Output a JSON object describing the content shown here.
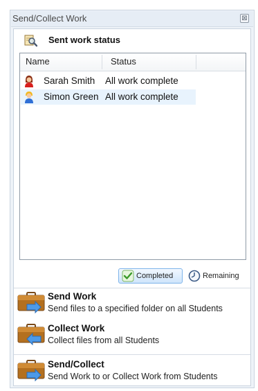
{
  "window": {
    "title": "Send/Collect Work",
    "close_glyph": "⊠"
  },
  "section": {
    "title": "Sent work status",
    "icon": "magnifier-document-icon"
  },
  "list": {
    "columns": [
      "Name",
      "Status"
    ],
    "rows": [
      {
        "name": "Sarah Smith",
        "status": "All work complete",
        "avatar": "student-female-icon",
        "selected": false
      },
      {
        "name": "Simon Green",
        "status": "All work complete",
        "avatar": "student-male-icon",
        "selected": true
      }
    ]
  },
  "legend": {
    "completed_label": "Completed",
    "remaining_label": "Remaining"
  },
  "actions": [
    {
      "title": "Send Work",
      "description": "Send files to a specified folder on all Students",
      "icon": "briefcase-send-icon"
    },
    {
      "title": "Collect Work",
      "description": "Collect files from all Students",
      "icon": "briefcase-collect-icon"
    },
    {
      "title": "Send/Collect",
      "description": "Send Work to or Collect Work from Students",
      "icon": "briefcase-sendcollect-icon"
    }
  ],
  "colors": {
    "accent": "#7eb4ea",
    "selection": "#e8f3fd",
    "panel": "#eef3f8"
  }
}
